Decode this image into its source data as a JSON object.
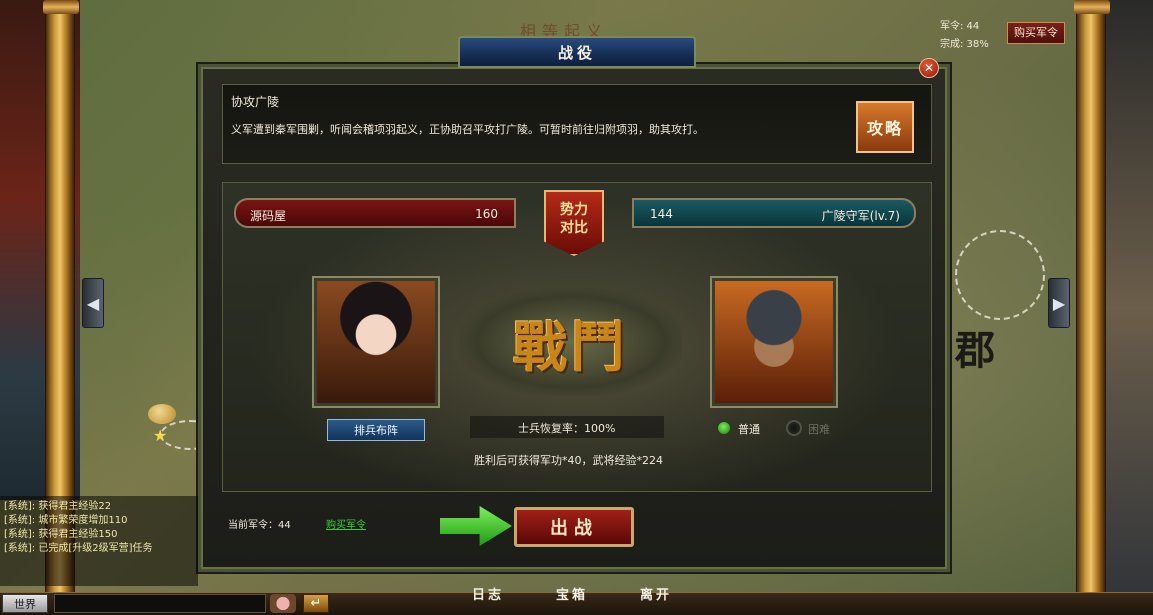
{
  "hud": {
    "command_label": "军令: 44",
    "clan_label": "宗成: 38%",
    "buy_command": "购买军令"
  },
  "dialog": {
    "title": "战役",
    "close_glyph": "✕"
  },
  "mission": {
    "title": "协攻广陵",
    "description": "义军遭到秦军围剿，听闻会稽项羽起义，正协助召平攻打广陵。可暂时前往归附项羽，助其攻打。",
    "guide_button": "攻略"
  },
  "compare": {
    "player_name": "源码屋",
    "player_power": "160",
    "badge_line1": "势力",
    "badge_line2": "对比",
    "enemy_power": "144",
    "enemy_name": "广陵守军(lv.7)"
  },
  "battle": {
    "emblem_text": "戰鬥",
    "formation_button": "排兵布阵",
    "recovery_text": "士兵恢复率：100%",
    "reward_text": "胜利后可获得军功*40，武将经验*224",
    "difficulty_normal": "普通",
    "difficulty_hard": "困难",
    "current_command": "当前军令：44",
    "buy_command_link": "购买军令",
    "fight_button": "出战"
  },
  "chat": {
    "lines": [
      "[系统]: 获得君主经验22",
      "[系统]: 城市繁荣度增加110",
      "[系统]: 获得君主经验150",
      "[系统]: 已完成[升级2级军营]任务"
    ],
    "channel_button": "世界",
    "send_glyph": "↵"
  },
  "bottom_menu": {
    "daily": "日志",
    "treasure": "宝箱",
    "leave": "离开"
  },
  "map": {
    "char": "郡"
  },
  "side_arrows": {
    "left": "◀",
    "right": "▶"
  },
  "colors": {
    "fight_button": "#a02018",
    "link_green": "#36d03a",
    "player_bar": "#7a1414",
    "enemy_bar": "#1a5a62"
  }
}
